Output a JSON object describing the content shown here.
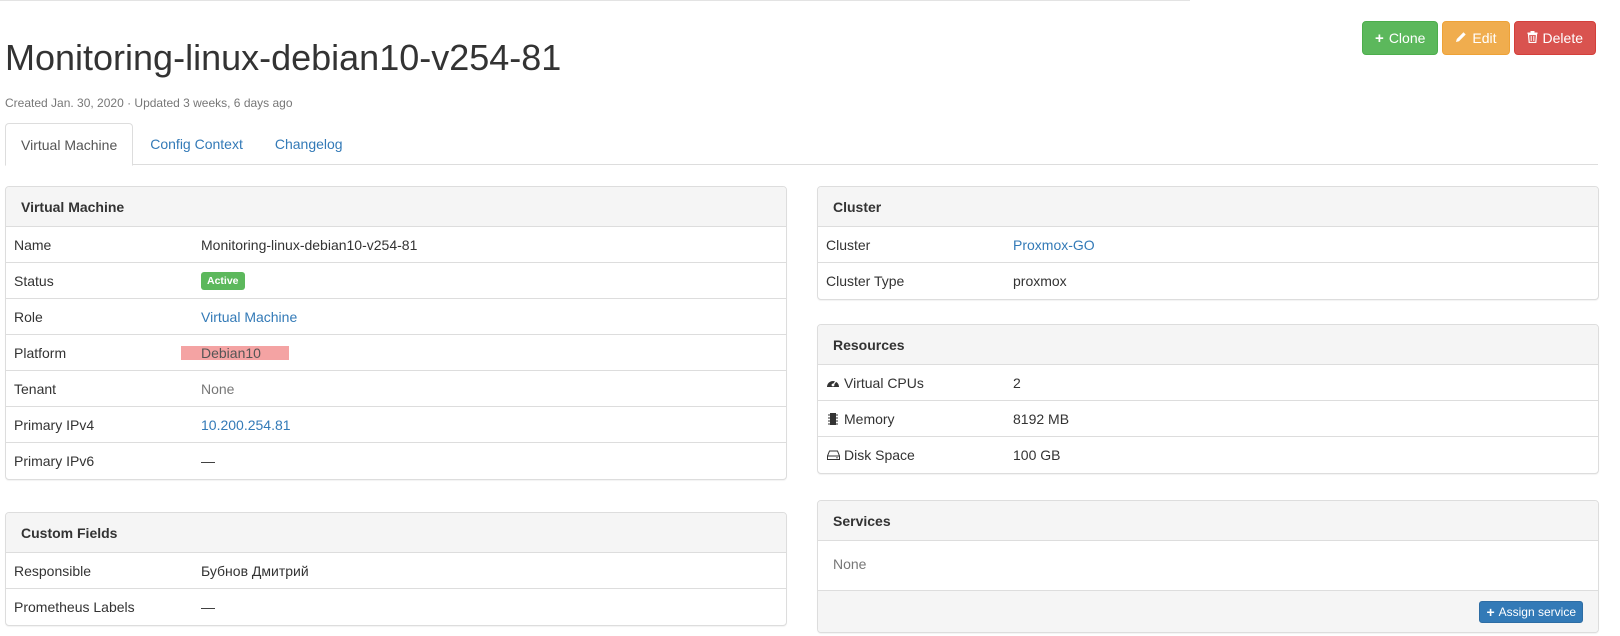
{
  "header": {
    "title": "Monitoring-linux-debian10-v254-81",
    "subtitle": "Created Jan. 30, 2020 · Updated 3 weeks, 6 days ago"
  },
  "actions": {
    "clone_label": "Clone",
    "edit_label": "Edit",
    "delete_label": "Delete"
  },
  "tabs": [
    {
      "label": "Virtual Machine",
      "active": true
    },
    {
      "label": "Config Context",
      "active": false
    },
    {
      "label": "Changelog",
      "active": false
    }
  ],
  "vm_panel": {
    "heading": "Virtual Machine",
    "rows": [
      {
        "label": "Name",
        "value": "Monitoring-linux-debian10-v254-81"
      },
      {
        "label": "Status",
        "value": "Active"
      },
      {
        "label": "Role",
        "value": "Virtual Machine"
      },
      {
        "label": "Platform",
        "value": "Debian10"
      },
      {
        "label": "Tenant",
        "value": "None"
      },
      {
        "label": "Primary IPv4",
        "value": "10.200.254.81"
      },
      {
        "label": "Primary IPv6",
        "value": "—"
      }
    ]
  },
  "custom_fields": {
    "heading": "Custom Fields",
    "rows": [
      {
        "label": "Responsible",
        "value": "Бубнов Дмитрий"
      },
      {
        "label": "Prometheus Labels",
        "value": "—"
      }
    ]
  },
  "cluster_panel": {
    "heading": "Cluster",
    "rows": [
      {
        "label": "Cluster",
        "value": "Proxmox-GO"
      },
      {
        "label": "Cluster Type",
        "value": "proxmox"
      }
    ]
  },
  "resources_panel": {
    "heading": "Resources",
    "rows": [
      {
        "label": "Virtual CPUs",
        "value": "2",
        "icon": "dashboard-icon"
      },
      {
        "label": "Memory",
        "value": "8192 MB",
        "icon": "memory-chip-icon"
      },
      {
        "label": "Disk Space",
        "value": "100 GB",
        "icon": "hard-drive-icon"
      }
    ]
  },
  "services_panel": {
    "heading": "Services",
    "body": "None",
    "assign_label": "Assign service"
  },
  "colors": {
    "success": "#5cb85c",
    "warning": "#f0ad4e",
    "danger": "#d9534f",
    "primary": "#337ab7",
    "highlight": "#f4a3a3"
  }
}
